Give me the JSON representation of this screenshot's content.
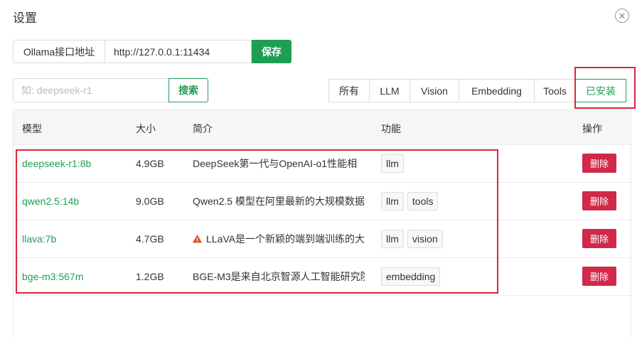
{
  "dialog": {
    "title": "设置",
    "close_icon": "close-icon"
  },
  "api": {
    "label": "Ollama接口地址",
    "value": "http://127.0.0.1:11434",
    "save_label": "保存"
  },
  "search": {
    "placeholder": "如: deepseek-r1",
    "button_label": "搜索"
  },
  "filters": [
    {
      "label": "所有",
      "active": false
    },
    {
      "label": "LLM",
      "active": false
    },
    {
      "label": "Vision",
      "active": false
    },
    {
      "label": "Embedding",
      "active": false
    },
    {
      "label": "Tools",
      "active": false
    },
    {
      "label": "已安装",
      "active": true
    }
  ],
  "table": {
    "headers": {
      "model": "模型",
      "size": "大小",
      "desc": "简介",
      "features": "功能",
      "actions": "操作"
    },
    "rows": [
      {
        "name": "deepseek-r1:8b",
        "size": "4.9GB",
        "desc": "DeepSeek第一代与OpenAI-o1性能相",
        "tags": [
          "llm"
        ],
        "delete_label": "删除"
      },
      {
        "name": "qwen2.5:14b",
        "size": "9.0GB",
        "desc": "Qwen2.5 模型在阿里最新的大规模数据",
        "tags": [
          "llm",
          "tools"
        ],
        "delete_label": "删除"
      },
      {
        "name": "llava:7b",
        "size": "4.7GB",
        "desc": "LLaVA是一个新颖的端到端训练的大",
        "tags": [
          "llm",
          "vision"
        ],
        "delete_label": "删除",
        "icon": "warning-triangle-icon"
      },
      {
        "name": "bge-m3:567m",
        "size": "1.2GB",
        "desc": "BGE-M3是来自北京智源人工智能研究院",
        "tags": [
          "embedding"
        ],
        "delete_label": "删除"
      }
    ]
  },
  "colors": {
    "accent": "#1f9d55",
    "danger": "#d02949",
    "highlight": "#d9263a"
  }
}
